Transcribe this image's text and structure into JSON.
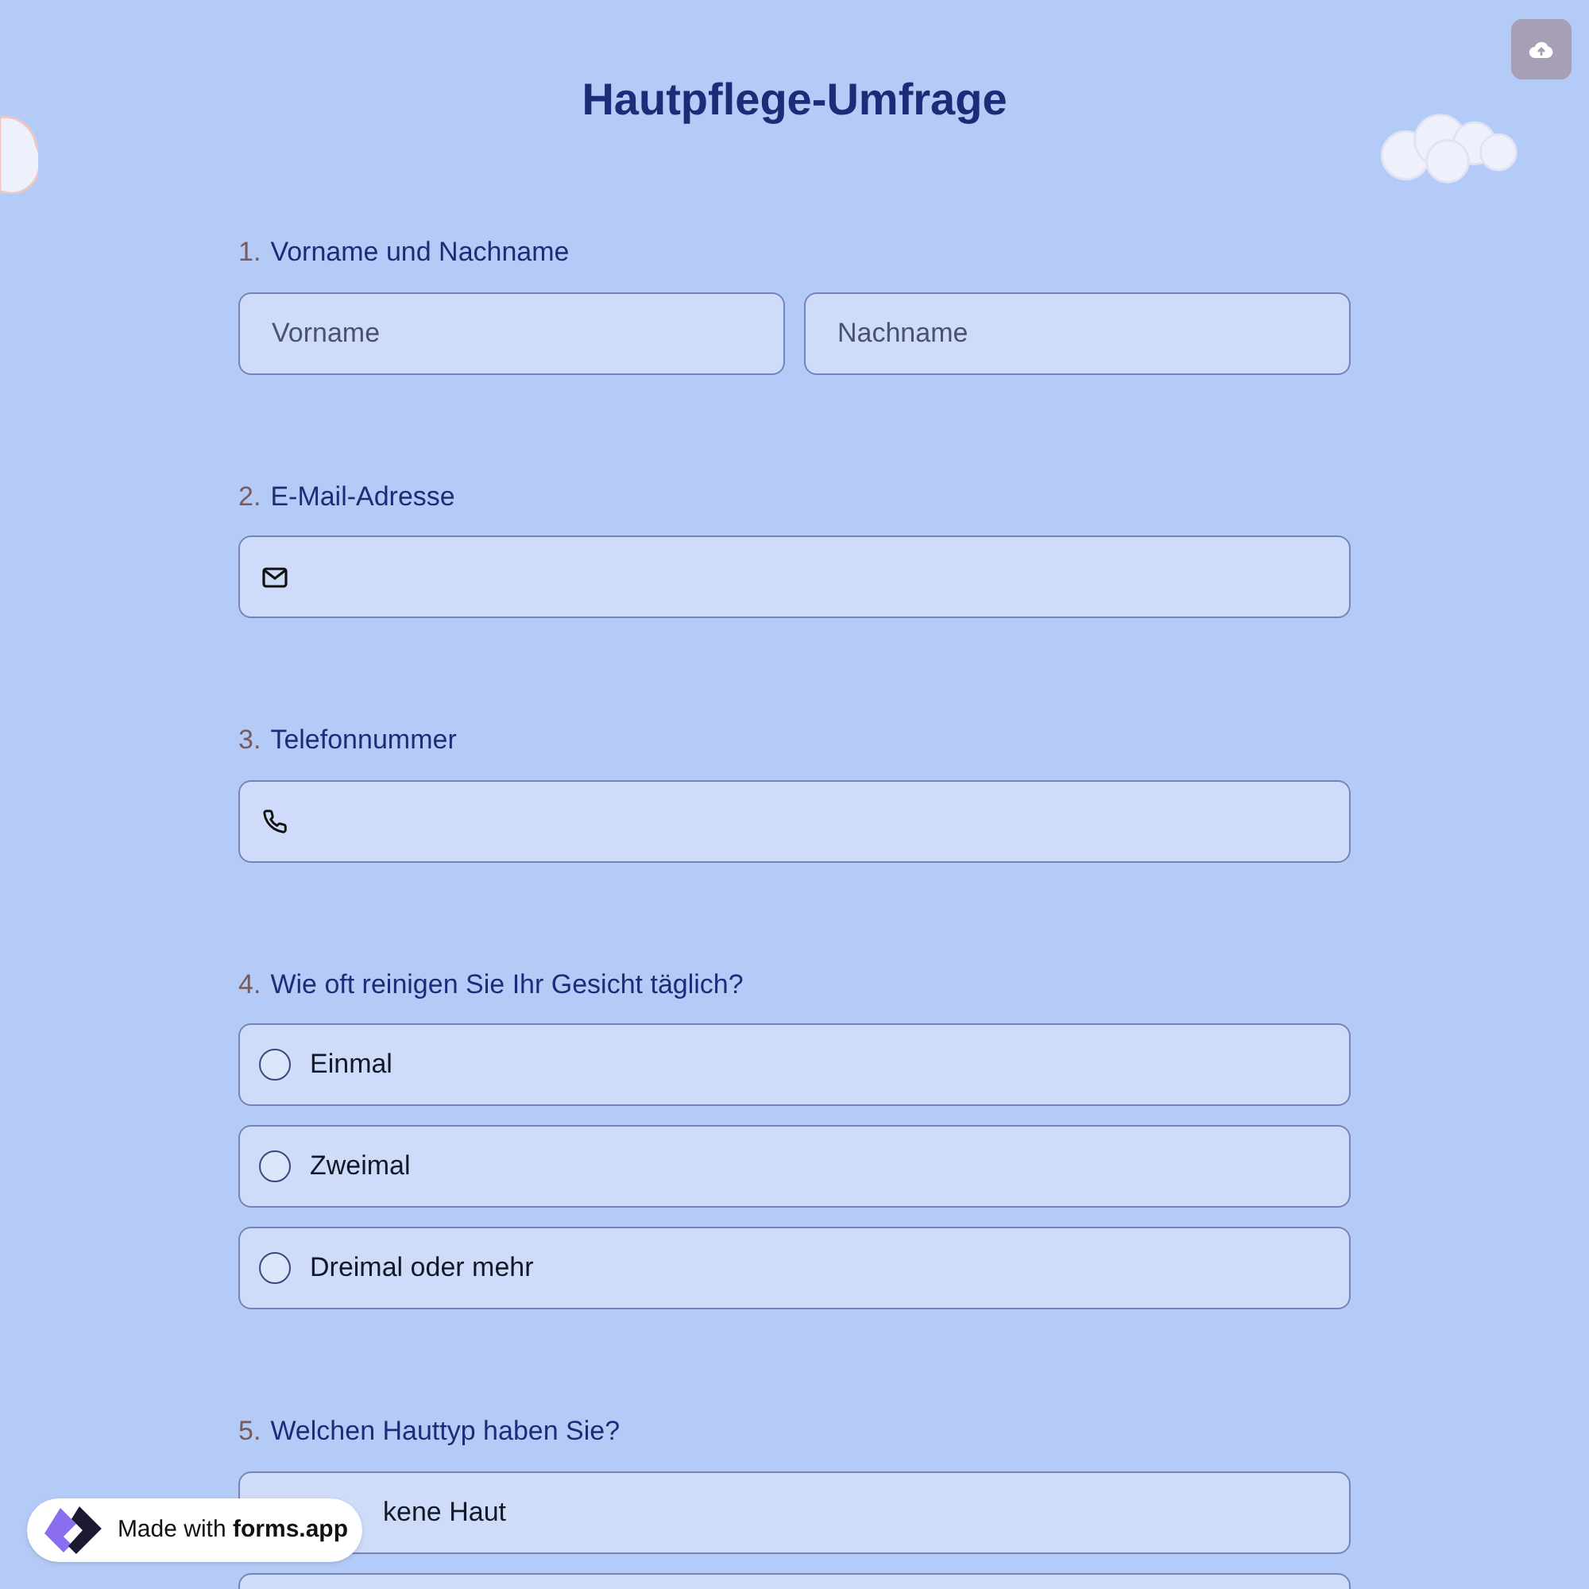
{
  "title": "Hautpflege-Umfrage",
  "questions": [
    {
      "number": "1.",
      "label": "Vorname und Nachname",
      "kind": "name",
      "placeholders": [
        "Vorname",
        "Nachname"
      ]
    },
    {
      "number": "2.",
      "label": "E-Mail-Adresse",
      "kind": "email"
    },
    {
      "number": "3.",
      "label": "Telefonnummer",
      "kind": "phone"
    },
    {
      "number": "4.",
      "label": "Wie oft reinigen Sie Ihr Gesicht täglich?",
      "kind": "choice",
      "options": [
        {
          "label": "Einmal",
          "selected": false
        },
        {
          "label": "Zweimal",
          "selected": false
        },
        {
          "label": "Dreimal oder mehr",
          "selected": false
        }
      ]
    },
    {
      "number": "5.",
      "label": "Welchen Hauttyp haben Sie?",
      "kind": "choice",
      "covered": true,
      "more_below": true,
      "options": [
        {
          "label": "kene Haut"
        }
      ]
    }
  ],
  "badge": {
    "text": "Made with **forms.app**"
  }
}
